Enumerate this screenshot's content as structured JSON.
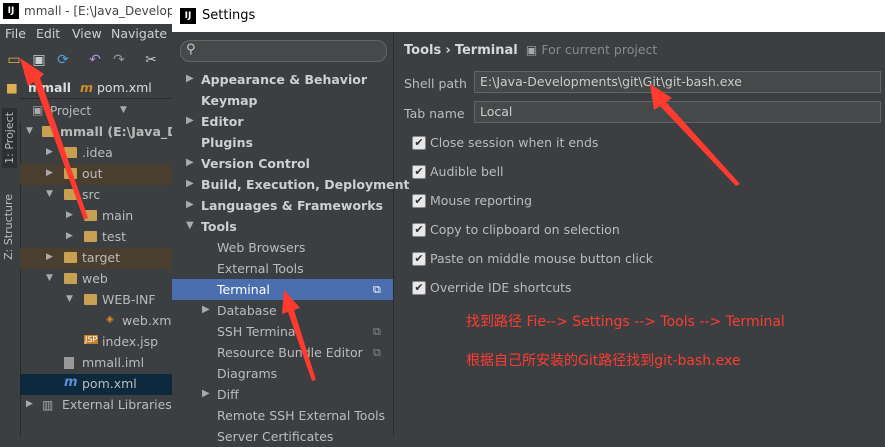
{
  "ide": {
    "title": "mmall - [E:\\Java_Develop",
    "logo": "IJ",
    "menu": [
      "File",
      "Edit",
      "View",
      "Navigate"
    ],
    "breadcrumb": [
      "mmall",
      "pom.xml"
    ],
    "project_label": "Project",
    "side_tabs": [
      "1: Project",
      "Z: Structure"
    ],
    "tree": [
      {
        "label": "mmall (E:\\Java_De",
        "icon": "folder-icon"
      },
      {
        "label": ".idea",
        "icon": "folder-icon"
      },
      {
        "label": "out",
        "icon": "folder-icon"
      },
      {
        "label": "src",
        "icon": "folder-icon"
      },
      {
        "label": "main",
        "icon": "folder-icon"
      },
      {
        "label": "test",
        "icon": "folder-icon"
      },
      {
        "label": "target",
        "icon": "folder-icon"
      },
      {
        "label": "web",
        "icon": "folder-icon"
      },
      {
        "label": "WEB-INF",
        "icon": "folder-icon"
      },
      {
        "label": "web.xml",
        "icon": "xml-file-icon"
      },
      {
        "label": "index.jsp",
        "icon": "jsp-file-icon"
      },
      {
        "label": "mmall.iml",
        "icon": "iml-file-icon"
      },
      {
        "label": "pom.xml",
        "icon": "maven-file-icon"
      },
      {
        "label": "External Libraries",
        "icon": "library-icon"
      }
    ]
  },
  "dialog": {
    "logo": "IJ",
    "title": "Settings",
    "search_placeholder": "",
    "nav": [
      {
        "label": "Appearance & Behavior",
        "bold": true,
        "expander": "▶"
      },
      {
        "label": "Keymap",
        "bold": true,
        "expander": ""
      },
      {
        "label": "Editor",
        "bold": true,
        "expander": "▶"
      },
      {
        "label": "Plugins",
        "bold": true,
        "expander": ""
      },
      {
        "label": "Version Control",
        "bold": true,
        "expander": "▶"
      },
      {
        "label": "Build, Execution, Deployment",
        "bold": true,
        "expander": "▶"
      },
      {
        "label": "Languages & Frameworks",
        "bold": true,
        "expander": "▶"
      },
      {
        "label": "Tools",
        "bold": true,
        "expander": "▼"
      },
      {
        "label": "Web Browsers",
        "bold": false,
        "expander": ""
      },
      {
        "label": "External Tools",
        "bold": false,
        "expander": ""
      },
      {
        "label": "Terminal",
        "bold": false,
        "expander": "",
        "selected": true
      },
      {
        "label": "Database",
        "bold": false,
        "expander": "▶"
      },
      {
        "label": "SSH Terminal",
        "bold": false,
        "expander": ""
      },
      {
        "label": "Resource Bundle Editor",
        "bold": false,
        "expander": ""
      },
      {
        "label": "Diagrams",
        "bold": false,
        "expander": ""
      },
      {
        "label": "Diff",
        "bold": false,
        "expander": "▶"
      },
      {
        "label": "Remote SSH External Tools",
        "bold": false,
        "expander": ""
      },
      {
        "label": "Server Certificates",
        "bold": false,
        "expander": ""
      }
    ],
    "crumb": {
      "part1": "Tools",
      "sep": "›",
      "part2": "Terminal",
      "scope": "For current project"
    },
    "shell_path": {
      "label": "Shell path",
      "value": "E:\\Java-Developments\\git\\Git\\git-bash.exe"
    },
    "tab_name": {
      "label": "Tab name",
      "value": "Local"
    },
    "options": [
      {
        "label": "Close session when it ends",
        "checked": true
      },
      {
        "label": "Audible bell",
        "checked": true
      },
      {
        "label": "Mouse reporting",
        "checked": true
      },
      {
        "label": "Copy to clipboard on selection",
        "checked": true
      },
      {
        "label": "Paste on middle mouse button click",
        "checked": true
      },
      {
        "label": "Override IDE shortcuts",
        "checked": true
      }
    ],
    "notes": [
      "找到路径  Fie--> Settings -->  Tools --> Terminal",
      "根据自己所安装的Git路径找到git-bash.exe"
    ]
  },
  "colors": {
    "accent": "#4b6eaf",
    "annotation": "#ff3b30",
    "bg": "#3c3f41"
  }
}
